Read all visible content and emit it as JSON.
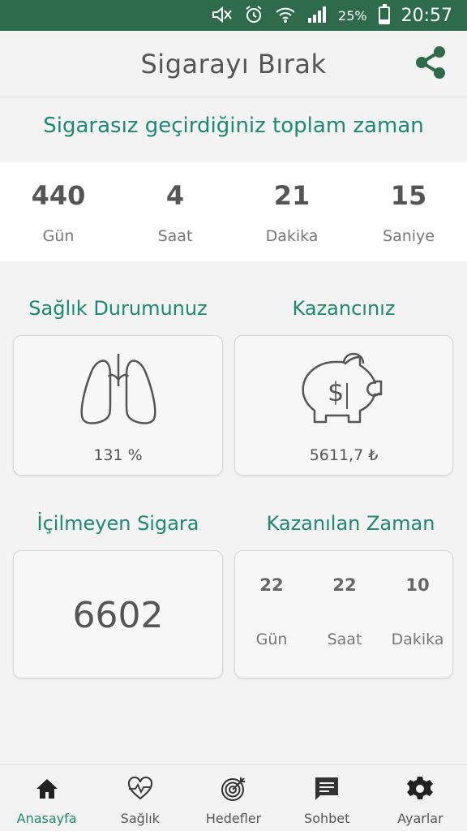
{
  "status": {
    "battery": "25%",
    "time": "20:57",
    "battery_level": 0.25
  },
  "appbar": {
    "title": "Sigarayı Bırak"
  },
  "total_time": {
    "title": "Sigarasız geçirdiğiniz toplam zaman",
    "units": [
      {
        "value": "440",
        "label": "Gün"
      },
      {
        "value": "4",
        "label": "Saat"
      },
      {
        "value": "21",
        "label": "Dakika"
      },
      {
        "value": "15",
        "label": "Saniye"
      }
    ]
  },
  "health": {
    "title": "Sağlık Durumunuz",
    "value": "131 %"
  },
  "earnings": {
    "title": "Kazancınız",
    "value": "5611,7 ₺"
  },
  "cigarettes": {
    "title": "İçilmeyen Sigara",
    "value": "6602"
  },
  "gained_time": {
    "title": "Kazanılan Zaman",
    "units": [
      {
        "value": "22",
        "label": "Gün"
      },
      {
        "value": "22",
        "label": "Saat"
      },
      {
        "value": "10",
        "label": "Dakika"
      }
    ]
  },
  "nav": [
    {
      "label": "Anasayfa",
      "icon": "home-icon"
    },
    {
      "label": "Sağlık",
      "icon": "heart-pulse-icon"
    },
    {
      "label": "Hedefler",
      "icon": "target-icon"
    },
    {
      "label": "Sohbet",
      "icon": "chat-icon"
    },
    {
      "label": "Ayarlar",
      "icon": "gear-icon"
    }
  ],
  "colors": {
    "statusbar": "#2e6b4a",
    "accent": "#1a8a70",
    "text": "#555555"
  }
}
